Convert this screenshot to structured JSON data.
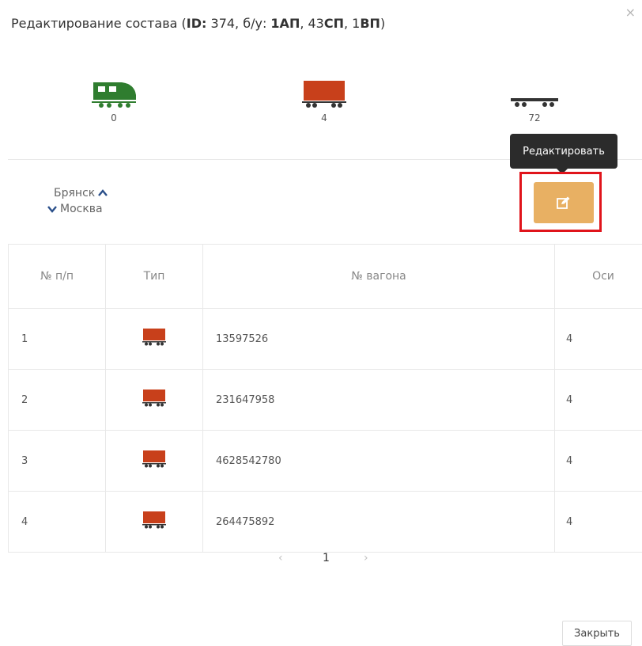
{
  "header": {
    "title_prefix": "Редактирование состава (",
    "id_label": "ID:",
    "id_value": " 374, б/у: ",
    "ap": "1АП",
    "sep1": ", 43",
    "sp": "СП",
    "sep2": ", 1",
    "vp": "ВП",
    "title_suffix": ")",
    "close_icon": "×"
  },
  "summary": {
    "locomotive": {
      "icon": "locomotive-icon",
      "count": "0",
      "color": "#2f7d2f"
    },
    "freight_car": {
      "icon": "freight-car-icon",
      "count": "4",
      "color": "#c8401b"
    },
    "flatcar": {
      "icon": "flatcar-icon",
      "count": "72",
      "color": "#333333"
    }
  },
  "tooltip": {
    "text": "Редактировать"
  },
  "edit_button": {
    "icon": "edit-icon",
    "color": "#e8b063"
  },
  "route": {
    "from": "Брянск",
    "to": "Москва"
  },
  "table": {
    "headers": [
      "№ п/п",
      "Тип",
      "№ вагона",
      "Оси"
    ],
    "rows": [
      {
        "num": "1",
        "type_icon": "freight-car-icon",
        "wagon": "13597526",
        "axles": "4"
      },
      {
        "num": "2",
        "type_icon": "freight-car-icon",
        "wagon": "231647958",
        "axles": "4"
      },
      {
        "num": "3",
        "type_icon": "freight-car-icon",
        "wagon": "4628542780",
        "axles": "4"
      },
      {
        "num": "4",
        "type_icon": "freight-car-icon",
        "wagon": "264475892",
        "axles": "4"
      }
    ]
  },
  "pagination": {
    "prev": "‹",
    "page": "1",
    "next": "›"
  },
  "footer": {
    "close_label": "Закрыть"
  }
}
